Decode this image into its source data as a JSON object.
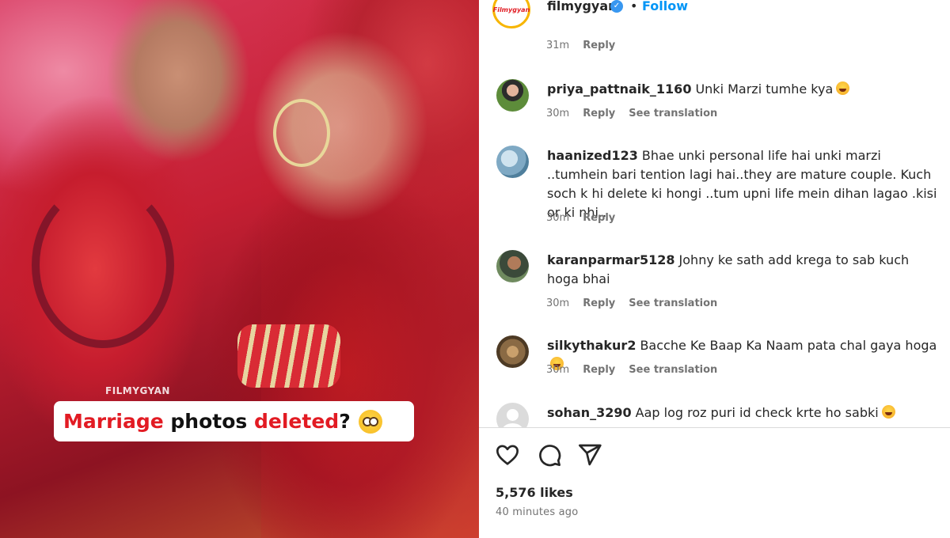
{
  "post": {
    "watermark": "FILMYGYAN",
    "caption": {
      "word1": "Marriage",
      "word2": " photos ",
      "word3": "deleted",
      "word4": "?"
    }
  },
  "header": {
    "brand_logo_text": "Filmygyan",
    "username": "filmygyan",
    "verified_icon": "✓",
    "separator": "•",
    "follow_label": "Follow"
  },
  "top_meta": {
    "time": "31m",
    "reply": "Reply"
  },
  "comments": [
    {
      "username": "priya_pattnaik_1160",
      "text": "Unki Marzi tumhe kya",
      "emoji": "laugh-cry-emoji",
      "time": "30m",
      "reply": "Reply",
      "translate": "See translation"
    },
    {
      "username": "haanized123",
      "text": "Bhae unki personal life hai unki marzi ..tumhein bari tention lagi hai..they are mature couple. Kuch soch k hi delete ki hongi ..tum upni life mein dihan lagao .kisi or ki nhi..",
      "time": "30m",
      "reply": "Reply"
    },
    {
      "username": "karanparmar5128",
      "text": "Johny ke sath add krega to sab kuch hoga bhai",
      "time": "30m",
      "reply": "Reply",
      "translate": "See translation"
    },
    {
      "username": "silkythakur2",
      "text": "Bacche Ke Baap Ka Naam pata chal gaya hoga",
      "emoji": "laugh-cry-emoji",
      "time": "30m",
      "reply": "Reply",
      "translate": "See translation"
    },
    {
      "username": "sohan_3290",
      "text": "Aap log roz puri id check krte ho sabki",
      "emoji": "laugh-cry-emoji"
    }
  ],
  "footer": {
    "likes": "5,576 likes",
    "posted": "40 minutes ago"
  },
  "icons": {
    "like": "heart-icon",
    "comment": "comment-icon",
    "share": "share-icon"
  },
  "colors": {
    "link_blue": "#0095f6",
    "verified_blue": "#3897f0",
    "caption_red": "#e21b23",
    "meta_gray": "#737373"
  }
}
